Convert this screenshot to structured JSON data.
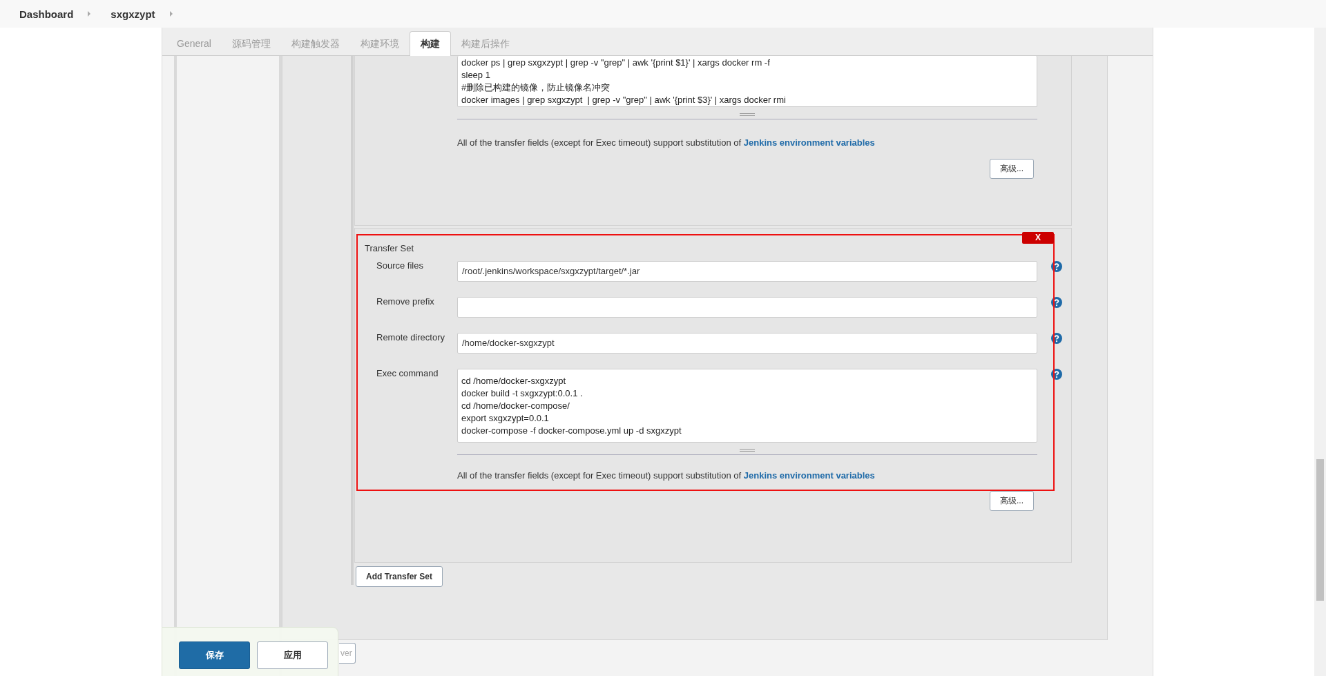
{
  "breadcrumbs": [
    {
      "label": "Dashboard"
    },
    {
      "label": "sxgxzypt"
    }
  ],
  "tabs": [
    {
      "label": "General",
      "selected": false
    },
    {
      "label": "源码管理",
      "selected": false
    },
    {
      "label": "构建触发器",
      "selected": false
    },
    {
      "label": "构建环境",
      "selected": false
    },
    {
      "label": "构建",
      "selected": true
    },
    {
      "label": "构建后操作",
      "selected": false
    }
  ],
  "previous_transfer_set": {
    "exec_command_lines": [
      "docker ps | grep sxgxzypt | grep -v \"grep\" | awk '{print $1}' | xargs docker rm -f",
      "sleep 1",
      "#删除已构建的镜像，防止镜像名冲突",
      "docker images | grep sxgxzypt  | grep -v \"grep\" | awk '{print $3}' | xargs docker rmi"
    ],
    "note": {
      "text": "All of the transfer fields (except for Exec timeout) support substitution of ",
      "link": "Jenkins environment variables"
    },
    "advanced_button": "高级..."
  },
  "transfer_set": {
    "title": "Transfer Set",
    "highlighted": true,
    "delete_button": "X",
    "fields": [
      {
        "kind": "input",
        "label": "Source files",
        "value": "/root/.jenkins/workspace/sxgxzypt/target/*.jar"
      },
      {
        "kind": "input",
        "label": "Remove prefix"
      },
      {
        "kind": "input",
        "label": "Remote directory",
        "value": "/home/docker-sxgxzypt"
      },
      {
        "kind": "textarea",
        "label": "Exec command",
        "lines": [
          "cd /home/docker-sxgxzypt",
          "docker build -t sxgxzypt:0.0.1 .",
          "cd /home/docker-compose/",
          "export sxgxzypt=0.0.1",
          "docker-compose -f docker-compose.yml up -d sxgxzypt"
        ]
      }
    ],
    "note": {
      "text": "All of the transfer fields (except for Exec timeout) support substitution of ",
      "link": "Jenkins environment variables"
    },
    "advanced_button": "高级..."
  },
  "add_transfer_set_button": "Add Transfer Set",
  "add_server_button": "ver",
  "footer_buttons": [
    {
      "label": "保存",
      "kind": "primary"
    },
    {
      "label": "应用",
      "kind": "secondary"
    }
  ]
}
